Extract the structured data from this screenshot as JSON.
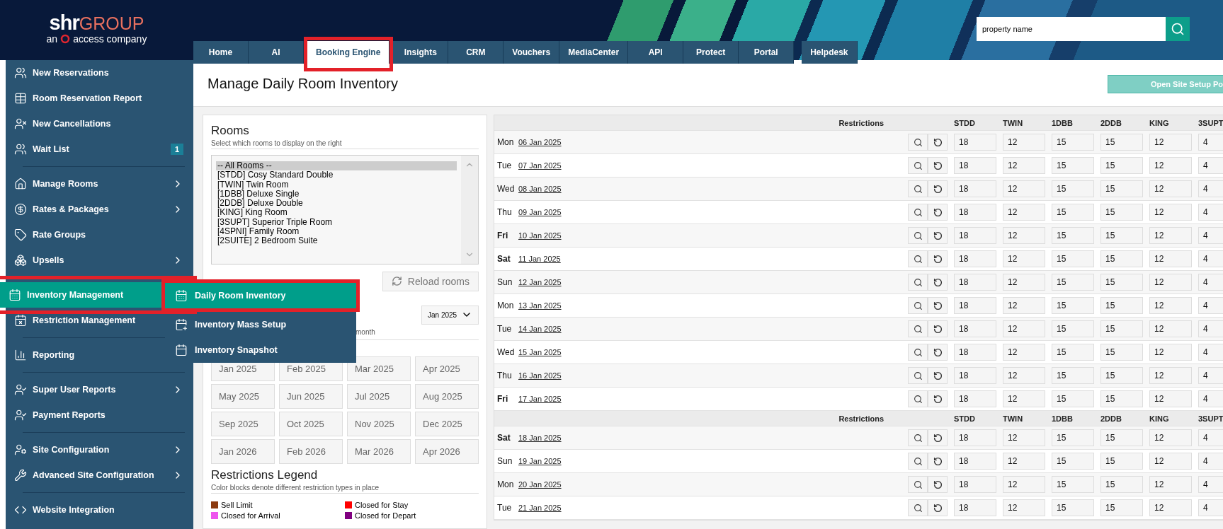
{
  "logo": {
    "brand": "shr",
    "group": "GROUP",
    "prefix": "an",
    "tagline": "access company"
  },
  "search": {
    "value": "property name"
  },
  "tabs": [
    {
      "label": "Home",
      "selected": false,
      "highlighted": false
    },
    {
      "label": "AI",
      "selected": false,
      "highlighted": false
    },
    {
      "label": "Booking Engine",
      "selected": true,
      "highlighted": true
    },
    {
      "label": "Insights",
      "selected": false,
      "highlighted": false
    },
    {
      "label": "CRM",
      "selected": false,
      "highlighted": false
    },
    {
      "label": "Vouchers",
      "selected": false,
      "highlighted": false
    },
    {
      "label": "MediaCenter",
      "selected": false,
      "highlighted": false
    },
    {
      "label": "API",
      "selected": false,
      "highlighted": false
    },
    {
      "label": "Protect",
      "selected": false,
      "highlighted": false
    },
    {
      "label": "Portal",
      "selected": false,
      "highlighted": false
    },
    {
      "label": "Helpdesk",
      "selected": false,
      "highlighted": false
    }
  ],
  "sidebar": {
    "items": [
      {
        "kind": "item",
        "label": "New Reservations",
        "submenu": false,
        "selected": false,
        "highlighted": false
      },
      {
        "kind": "item",
        "label": "Room Reservation Report",
        "submenu": false,
        "selected": false,
        "highlighted": false
      },
      {
        "kind": "item",
        "label": "New Cancellations",
        "submenu": false,
        "selected": false,
        "highlighted": false
      },
      {
        "kind": "item",
        "label": "Wait List",
        "badge": "1",
        "submenu": false,
        "selected": false,
        "highlighted": false
      },
      {
        "kind": "divider"
      },
      {
        "kind": "item",
        "label": "Manage Rooms",
        "submenu": true,
        "selected": false,
        "highlighted": false
      },
      {
        "kind": "item",
        "label": "Rates & Packages",
        "submenu": true,
        "selected": false,
        "highlighted": false
      },
      {
        "kind": "item",
        "label": "Rate Groups",
        "submenu": false,
        "selected": false,
        "highlighted": false
      },
      {
        "kind": "item",
        "label": "Upsells",
        "submenu": true,
        "selected": false,
        "highlighted": false
      },
      {
        "kind": "divider"
      },
      {
        "kind": "item",
        "label": "Inventory Management",
        "submenu": false,
        "selected": true,
        "highlighted": true
      },
      {
        "kind": "item",
        "label": "Restriction Management",
        "submenu": false,
        "selected": false,
        "highlighted": false
      },
      {
        "kind": "divider"
      },
      {
        "kind": "item",
        "label": "Reporting",
        "submenu": false,
        "selected": false,
        "highlighted": false
      },
      {
        "kind": "divider"
      },
      {
        "kind": "item",
        "label": "Super User Reports",
        "submenu": true,
        "selected": false,
        "highlighted": false
      },
      {
        "kind": "item",
        "label": "Payment Reports",
        "submenu": false,
        "selected": false,
        "highlighted": false
      },
      {
        "kind": "divider"
      },
      {
        "kind": "item",
        "label": "Site Configuration",
        "submenu": true,
        "selected": false,
        "highlighted": false
      },
      {
        "kind": "item",
        "label": "Advanced Site Configuration",
        "submenu": true,
        "selected": false,
        "highlighted": false
      },
      {
        "kind": "divider"
      },
      {
        "kind": "item",
        "label": "Website Integration",
        "submenu": false,
        "selected": false,
        "highlighted": false
      }
    ],
    "flyout": [
      {
        "label": "Daily Room Inventory",
        "selected": true,
        "highlighted": true
      },
      {
        "label": "Inventory Mass Setup",
        "selected": false,
        "highlighted": false
      },
      {
        "label": "Inventory Snapshot",
        "selected": false,
        "highlighted": false
      }
    ]
  },
  "page": {
    "title": "Manage Daily Room Inventory",
    "action_button": "Open Site Setup Po"
  },
  "rooms": {
    "title": "Rooms",
    "subtitle": "Select which rooms to display on the right",
    "options": [
      {
        "label": "-- All Rooms --",
        "selected": true
      },
      {
        "label": "[STDD] Cosy Standard Double",
        "selected": false
      },
      {
        "label": "[TWIN] Twin Room",
        "selected": false
      },
      {
        "label": "[1DBB] Deluxe Single",
        "selected": false
      },
      {
        "label": "[2DDB] Deluxe Double",
        "selected": false
      },
      {
        "label": "[KING] King Room",
        "selected": false
      },
      {
        "label": "[3SUPT] Superior Triple Room",
        "selected": false
      },
      {
        "label": "[4SPNI] Family Room",
        "selected": false
      },
      {
        "label": "[2SUITE] 2 Bedroom Suite",
        "selected": false
      }
    ],
    "reload_button": "Reload rooms"
  },
  "months": {
    "subtitle": "month",
    "select_value": "Jan 2025",
    "buttons": [
      "Jan 2025",
      "Feb 2025",
      "Mar 2025",
      "Apr 2025",
      "May 2025",
      "Jun 2025",
      "Jul 2025",
      "Aug 2025",
      "Sep 2025",
      "Oct 2025",
      "Nov 2025",
      "Dec 2025",
      "Jan 2026",
      "Feb 2026",
      "Mar 2026",
      "Apr 2026"
    ]
  },
  "legend": {
    "title": "Restrictions Legend",
    "subtitle": "Color blocks denote different restriction types in place",
    "items": [
      {
        "label": "Sell Limit",
        "color": "#8b3a0f"
      },
      {
        "label": "Closed for Stay",
        "color": "#ff0000"
      },
      {
        "label": "Closed for Arrival",
        "color": "#ee55ee"
      },
      {
        "label": "Closed for Depart",
        "color": "#800080"
      }
    ]
  },
  "table": {
    "groups": [
      {
        "header": {
          "restrictions": "Restrictions",
          "columns": [
            "STDD",
            "TWIN",
            "1DBB",
            "2DDB",
            "KING",
            "3SUPT"
          ]
        },
        "rows": [
          {
            "day": "Mon",
            "date": "06 Jan 2025",
            "weekend": false,
            "values": [
              "18",
              "12",
              "15",
              "15",
              "12",
              "4"
            ]
          },
          {
            "day": "Tue",
            "date": "07 Jan 2025",
            "weekend": false,
            "values": [
              "18",
              "12",
              "15",
              "15",
              "12",
              "4"
            ]
          },
          {
            "day": "Wed",
            "date": "08 Jan 2025",
            "weekend": false,
            "values": [
              "18",
              "12",
              "15",
              "15",
              "12",
              "4"
            ]
          },
          {
            "day": "Thu",
            "date": "09 Jan 2025",
            "weekend": false,
            "values": [
              "18",
              "12",
              "15",
              "15",
              "12",
              "4"
            ]
          },
          {
            "day": "Fri",
            "date": "10 Jan 2025",
            "weekend": true,
            "values": [
              "18",
              "12",
              "15",
              "15",
              "12",
              "4"
            ]
          },
          {
            "day": "Sat",
            "date": "11 Jan 2025",
            "weekend": true,
            "values": [
              "18",
              "12",
              "15",
              "15",
              "12",
              "4"
            ]
          },
          {
            "day": "Sun",
            "date": "12 Jan 2025",
            "weekend": false,
            "values": [
              "18",
              "12",
              "15",
              "15",
              "12",
              "4"
            ]
          },
          {
            "day": "Mon",
            "date": "13 Jan 2025",
            "weekend": false,
            "values": [
              "18",
              "12",
              "15",
              "15",
              "12",
              "4"
            ]
          },
          {
            "day": "Tue",
            "date": "14 Jan 2025",
            "weekend": false,
            "values": [
              "18",
              "12",
              "15",
              "15",
              "12",
              "4"
            ]
          },
          {
            "day": "Wed",
            "date": "15 Jan 2025",
            "weekend": false,
            "values": [
              "18",
              "12",
              "15",
              "15",
              "12",
              "4"
            ]
          },
          {
            "day": "Thu",
            "date": "16 Jan 2025",
            "weekend": false,
            "values": [
              "18",
              "12",
              "15",
              "15",
              "12",
              "4"
            ]
          },
          {
            "day": "Fri",
            "date": "17 Jan 2025",
            "weekend": true,
            "values": [
              "18",
              "12",
              "15",
              "15",
              "12",
              "4"
            ]
          }
        ]
      },
      {
        "header": {
          "restrictions": "Restrictions",
          "columns": [
            "STDD",
            "TWIN",
            "1DBB",
            "2DDB",
            "KING",
            "3SUPT"
          ]
        },
        "rows": [
          {
            "day": "Sat",
            "date": "18 Jan 2025",
            "weekend": true,
            "values": [
              "18",
              "12",
              "15",
              "15",
              "12",
              "4"
            ]
          },
          {
            "day": "Sun",
            "date": "19 Jan 2025",
            "weekend": false,
            "values": [
              "18",
              "12",
              "15",
              "15",
              "12",
              "4"
            ]
          },
          {
            "day": "Mon",
            "date": "20 Jan 2025",
            "weekend": false,
            "values": [
              "18",
              "12",
              "15",
              "15",
              "12",
              "4"
            ]
          },
          {
            "day": "Tue",
            "date": "21 Jan 2025",
            "weekend": false,
            "values": [
              "18",
              "12",
              "15",
              "15",
              "12",
              "4"
            ]
          }
        ]
      }
    ]
  }
}
